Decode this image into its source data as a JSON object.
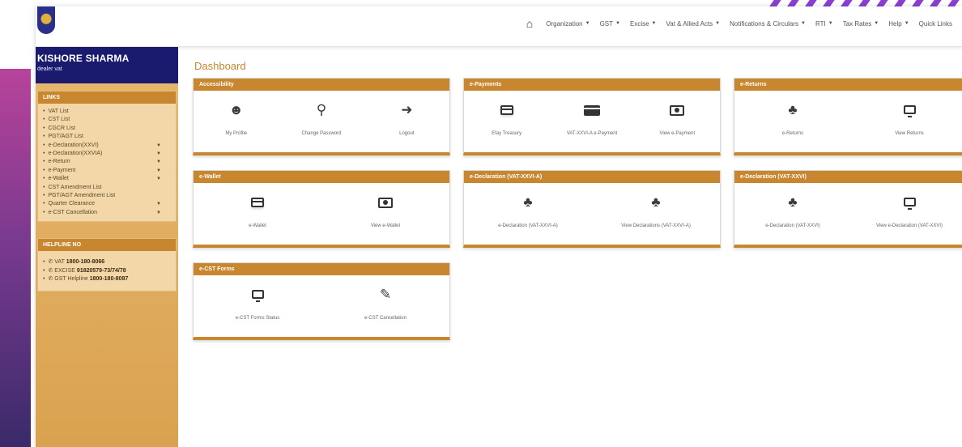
{
  "colors": {
    "accent": "#c8862e",
    "sidebar_header": "#1a1a6e",
    "sidebar_bg": "#e8b870",
    "panel_bg": "#f3d7a8"
  },
  "nav": {
    "home_icon": "home-icon",
    "items": [
      {
        "label": "Organization"
      },
      {
        "label": "GST"
      },
      {
        "label": "Excise"
      },
      {
        "label": "Vat & Allied Acts"
      },
      {
        "label": "Notifications & Circulars"
      },
      {
        "label": "RTI"
      },
      {
        "label": "Tax Rates"
      },
      {
        "label": "Help"
      },
      {
        "label": "Quick Links"
      }
    ]
  },
  "user": {
    "name": "KISHORE SHARMA",
    "role": "dealer vat"
  },
  "links_panel": {
    "title": "LINKS",
    "items": [
      {
        "label": "VAT List"
      },
      {
        "label": "CST List"
      },
      {
        "label": "CGCR List"
      },
      {
        "label": "PGT/AGT List"
      },
      {
        "label": "e-Declaration(XXVI)"
      },
      {
        "label": "e-Declaration(XXVIA)"
      },
      {
        "label": "e-Return"
      },
      {
        "label": "e-Payment"
      },
      {
        "label": "e-Wallet"
      },
      {
        "label": "CST Amendment List"
      },
      {
        "label": "PGT/AGT Amendment List"
      },
      {
        "label": "Quarter Clearance"
      },
      {
        "label": "e-CST Cancellation"
      }
    ]
  },
  "helpline_panel": {
    "title": "HELPLINE NO",
    "items": [
      {
        "label": "VAT",
        "number": "1800-180-8066"
      },
      {
        "label": "EXCISE",
        "number": "91820579-73/74/78"
      },
      {
        "label": "GST Helpline",
        "number": "1800-180-8087"
      }
    ]
  },
  "page_title": "Dashboard",
  "cards": {
    "accessibility": {
      "title": "Accessibility",
      "tiles": [
        {
          "label": "My Profile"
        },
        {
          "label": "Change Password"
        },
        {
          "label": "Logout"
        }
      ]
    },
    "payments": {
      "title": "e-Payments",
      "tiles": [
        {
          "label": "Efay Treasury"
        },
        {
          "label": "VAT-XXVI-A e-Payment"
        },
        {
          "label": "View e-Payment"
        }
      ]
    },
    "returns": {
      "title": "e-Returns",
      "tiles": [
        {
          "label": "e-Returns"
        },
        {
          "label": "View Returns"
        }
      ]
    },
    "wallet": {
      "title": "e-Wallet",
      "tiles": [
        {
          "label": "e-Wallet"
        },
        {
          "label": "View e-Wallet"
        }
      ]
    },
    "decl_a": {
      "title": "e-Declaration (VAT-XXVI-A)",
      "tiles": [
        {
          "label": "e-Declaration (VAT-XXVI-A)"
        },
        {
          "label": "View Declarations (VAT-XXVI-A)"
        }
      ]
    },
    "decl": {
      "title": "e-Declaration (VAT-XXVI)",
      "tiles": [
        {
          "label": "e-Declaration (VAT-XXVI)"
        },
        {
          "label": "View e-Declaration (VAT-XXVI)"
        }
      ]
    },
    "cst": {
      "title": "e-CST Forms",
      "tiles": [
        {
          "label": "e-CST Forms Status"
        },
        {
          "label": "e-CST Cancellation"
        }
      ]
    }
  }
}
